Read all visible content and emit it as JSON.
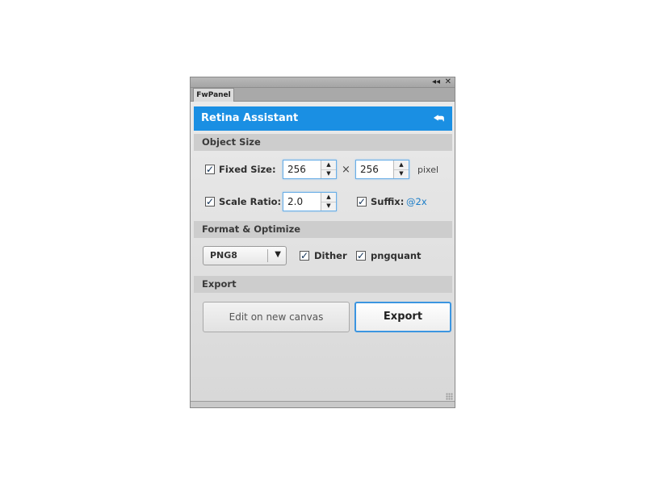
{
  "window": {
    "collapse_icon": "◂◂",
    "close_icon": "✕",
    "tab_label": "FwPanel"
  },
  "header": {
    "title": "Retina Assistant",
    "back_icon": "⮪"
  },
  "sections": {
    "object_size": "Object Size",
    "format": "Format & Optimize",
    "export": "Export"
  },
  "fixed_size": {
    "checked": true,
    "label": "Fixed Size:",
    "width": "256",
    "height": "256",
    "separator": "×",
    "unit": "pixel"
  },
  "scale_ratio": {
    "checked": true,
    "label": "Scale Ratio:",
    "value": "2.0"
  },
  "suffix": {
    "checked": true,
    "label": "Suffix:",
    "value": "@2x"
  },
  "format": {
    "selected": "PNG8",
    "dither": {
      "checked": true,
      "label": "Dither"
    },
    "pngquant": {
      "checked": true,
      "label": "pngquant"
    }
  },
  "export": {
    "edit_label": "Edit on new canvas",
    "export_label": "Export"
  },
  "glyphs": {
    "check": "✓",
    "up": "▲",
    "down": "▼",
    "caret": "▼"
  }
}
